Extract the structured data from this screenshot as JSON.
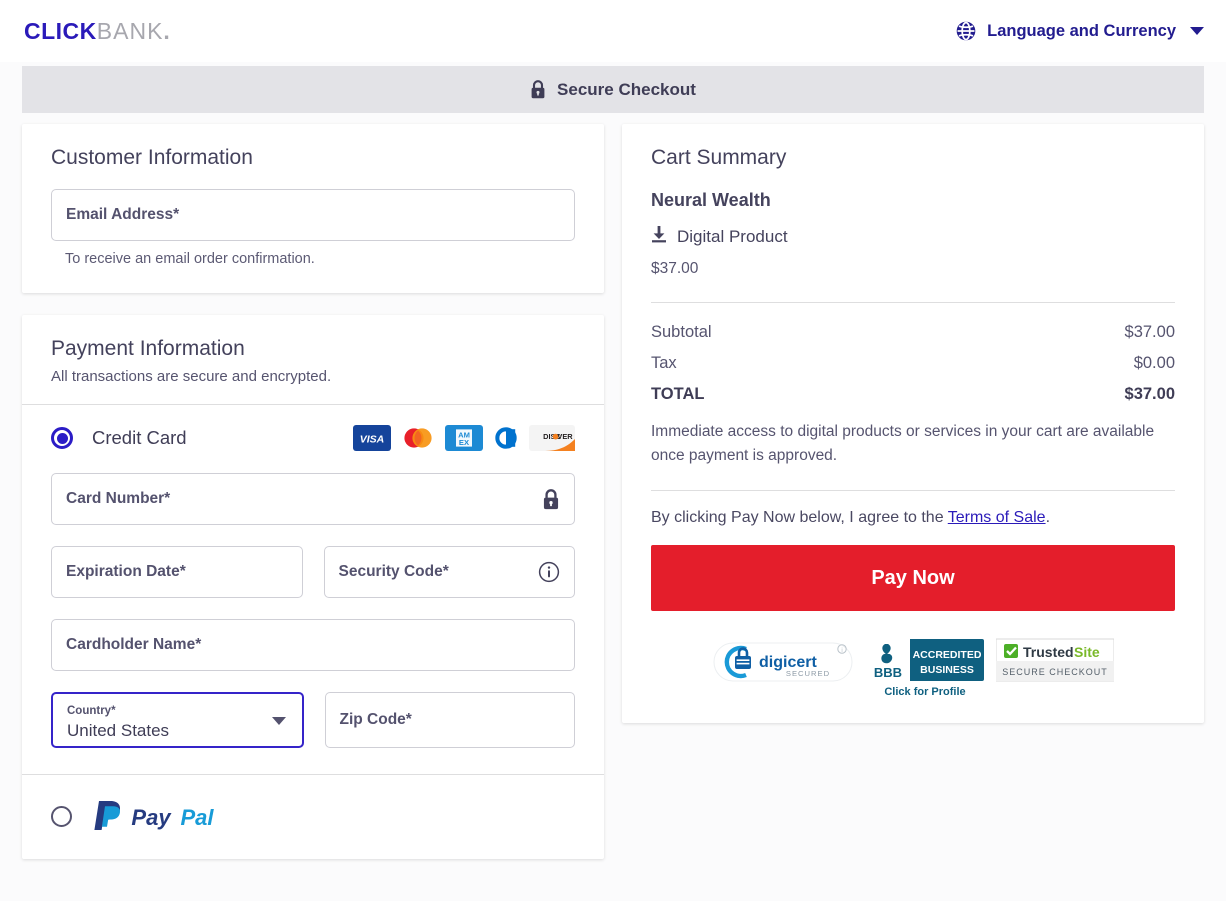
{
  "header": {
    "logo_click": "CLICK",
    "logo_bank": "BANK",
    "logo_dot": ".",
    "globe_icon": "globe-icon",
    "language_currency_label": "Language and Currency",
    "chevron_icon": "chevron-down-icon"
  },
  "secure_bar": {
    "lock_icon": "lock-icon",
    "label": "Secure Checkout"
  },
  "customer_information": {
    "title": "Customer Information",
    "email_placeholder": "Email Address*",
    "email_value": "",
    "helper": "To receive an email order confirmation."
  },
  "payment_information": {
    "title": "Payment Information",
    "subtitle": "All transactions are secure and encrypted.",
    "credit_card_label": "Credit Card",
    "card_brands": [
      "visa",
      "mastercard",
      "amex",
      "diners",
      "discover"
    ],
    "card_number_placeholder": "Card Number*",
    "card_number_value": "",
    "card_lock_icon": "lock-icon",
    "expiration_placeholder": "Expiration Date*",
    "expiration_value": "",
    "security_code_placeholder": "Security Code*",
    "security_code_value": "",
    "security_info_icon": "info-circle-icon",
    "cardholder_placeholder": "Cardholder Name*",
    "cardholder_value": "",
    "country_label": "Country*",
    "country_value": "United States",
    "country_caret_icon": "caret-down-icon",
    "zip_placeholder": "Zip Code*",
    "zip_value": "",
    "paypal_label": "PayPal",
    "paypal_pay": "Pay",
    "paypal_pal": "Pal"
  },
  "cart_summary": {
    "title": "Cart Summary",
    "product_name": "Neural Wealth",
    "product_type_icon": "download-icon",
    "product_type": "Digital Product",
    "product_price": "$37.00",
    "subtotal_label": "Subtotal",
    "subtotal_value": "$37.00",
    "tax_label": "Tax",
    "tax_value": "$0.00",
    "total_label": "TOTAL",
    "total_value": "$37.00",
    "note": "Immediate access to digital products or services in your cart are available once payment is approved.",
    "terms_prefix": "By clicking Pay Now below, I agree to the ",
    "terms_link": "Terms of Sale",
    "terms_suffix": ".",
    "pay_now_label": "Pay Now"
  },
  "badges": {
    "digicert_name": "digicert",
    "digicert_secured": "SECURED",
    "bbb_line1": "ACCREDITED",
    "bbb_line2": "BUSINESS",
    "bbb_mark": "BBB",
    "bbb_click": "Click for Profile",
    "trustedsite_trusted": "Trusted",
    "trustedsite_site": "Site",
    "trustedsite_sub": "SECURE CHECKOUT"
  },
  "colors": {
    "brand_blue": "#2a1ab9",
    "accent_red": "#e41e2b",
    "page_bg": "#fbfbfc",
    "bar_gray": "#e3e3e7",
    "text_dark": "#3f3d56"
  }
}
